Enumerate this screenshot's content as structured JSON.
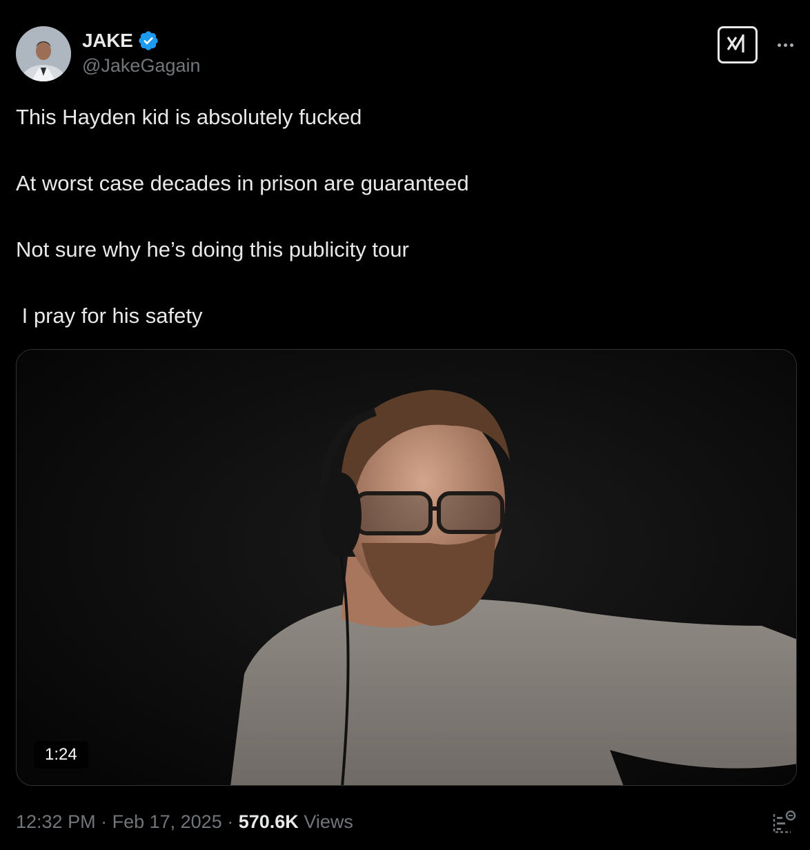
{
  "author": {
    "display_name": "JAKE",
    "handle": "@JakeGagain",
    "verified": true,
    "verified_color": "#1d9bf0"
  },
  "tweet": {
    "lines": [
      "This Hayden kid is absolutely fucked",
      "At worst case decades in prison are guaranteed",
      "Not sure why he’s doing this publicity tour",
      " I pray for his safety"
    ]
  },
  "media": {
    "type": "video",
    "duration": "1:24"
  },
  "footer": {
    "time": "12:32 PM",
    "separator": " · ",
    "date": "Feb 17, 2025",
    "views_count": "570.6K",
    "views_label": "Views"
  },
  "icons": {
    "verified": "verified-badge-icon",
    "grok": "grok-icon",
    "more": "more-icon",
    "analytics": "analytics-icon"
  },
  "colors": {
    "background": "#000000",
    "text_primary": "#e7e9ea",
    "text_secondary": "#71767b",
    "border": "#2f3336"
  }
}
